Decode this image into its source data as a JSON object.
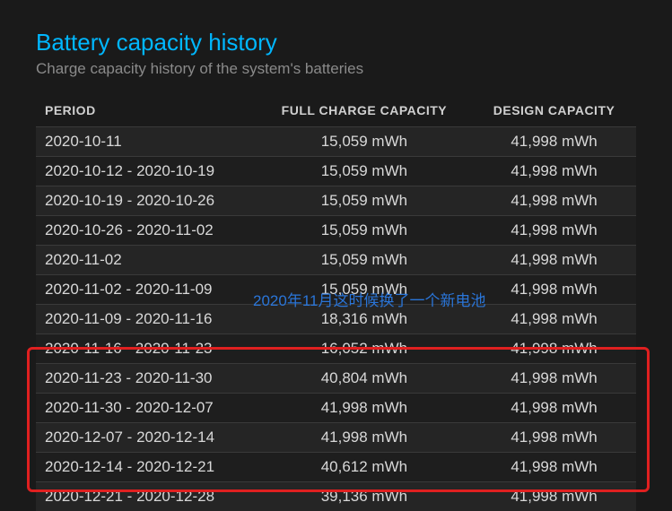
{
  "header": {
    "title": "Battery capacity history",
    "subtitle": "Charge capacity history of the system's batteries"
  },
  "table": {
    "columns": {
      "period": "PERIOD",
      "full": "FULL CHARGE CAPACITY",
      "design": "DESIGN CAPACITY"
    },
    "rows": [
      {
        "period": "2020-10-11",
        "full": "15,059 mWh",
        "design": "41,998 mWh"
      },
      {
        "period": "2020-10-12 - 2020-10-19",
        "full": "15,059 mWh",
        "design": "41,998 mWh"
      },
      {
        "period": "2020-10-19 - 2020-10-26",
        "full": "15,059 mWh",
        "design": "41,998 mWh"
      },
      {
        "period": "2020-10-26 - 2020-11-02",
        "full": "15,059 mWh",
        "design": "41,998 mWh"
      },
      {
        "period": "2020-11-02",
        "full": "15,059 mWh",
        "design": "41,998 mWh"
      },
      {
        "period": "2020-11-02 - 2020-11-09",
        "full": "15,059 mWh",
        "design": "41,998 mWh"
      },
      {
        "period": "2020-11-09 - 2020-11-16",
        "full": "18,316 mWh",
        "design": "41,998 mWh"
      },
      {
        "period": "2020-11-16 - 2020-11-23",
        "full": "16,052 mWh",
        "design": "41,998 mWh"
      },
      {
        "period": "2020-11-23 - 2020-11-30",
        "full": "40,804 mWh",
        "design": "41,998 mWh"
      },
      {
        "period": "2020-11-30 - 2020-12-07",
        "full": "41,998 mWh",
        "design": "41,998 mWh"
      },
      {
        "period": "2020-12-07 - 2020-12-14",
        "full": "41,998 mWh",
        "design": "41,998 mWh"
      },
      {
        "period": "2020-12-14 - 2020-12-21",
        "full": "40,612 mWh",
        "design": "41,998 mWh"
      },
      {
        "period": "2020-12-21 - 2020-12-28",
        "full": "39,136 mWh",
        "design": "41,998 mWh"
      }
    ]
  },
  "annotation": {
    "text": "2020年11月这时候换了一个新电池"
  }
}
